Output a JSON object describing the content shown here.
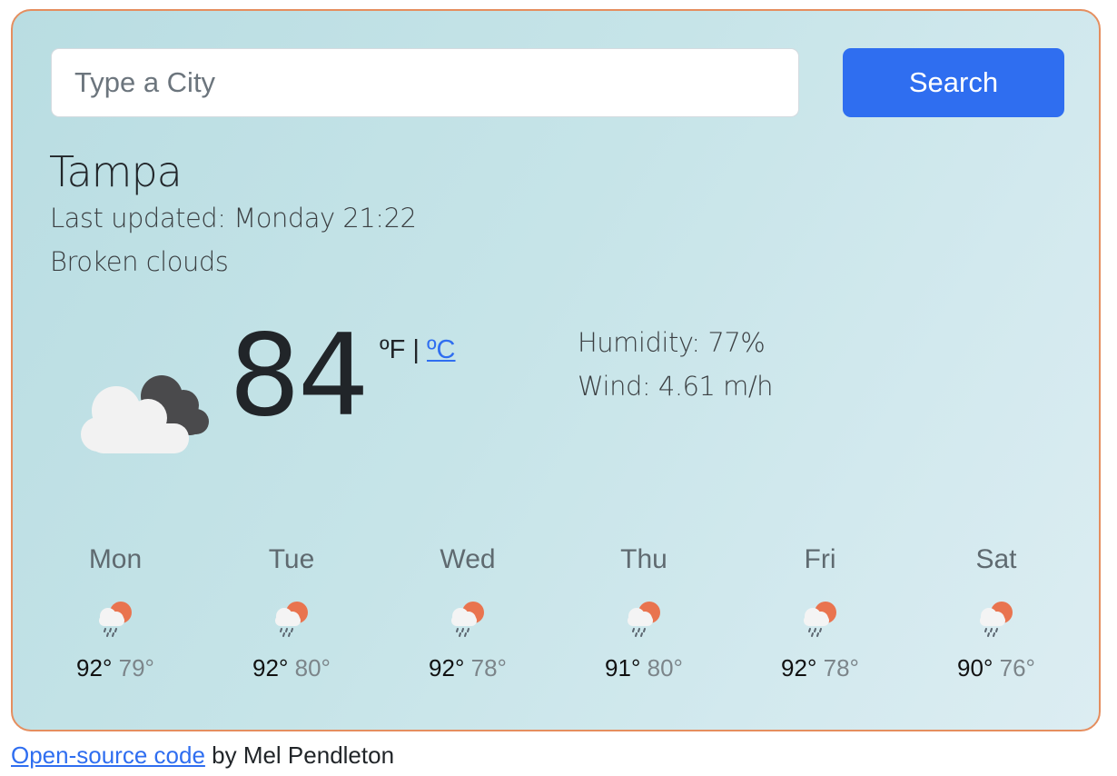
{
  "search": {
    "placeholder": "Type a City",
    "button_label": "Search"
  },
  "current": {
    "city": "Tampa",
    "last_updated": "Last updated: Monday 21:22",
    "description": "Broken clouds",
    "icon": "broken-clouds-icon",
    "temperature": "84",
    "unit_f": "ºF",
    "unit_separator": " | ",
    "unit_c": "ºC",
    "humidity": "Humidity: 77%",
    "wind": "Wind: 4.61 m/h"
  },
  "forecast": [
    {
      "day": "Mon",
      "icon": "rain-sun-icon",
      "max": "92°",
      "min": "79°"
    },
    {
      "day": "Tue",
      "icon": "rain-sun-icon",
      "max": "92°",
      "min": "80°"
    },
    {
      "day": "Wed",
      "icon": "rain-sun-icon",
      "max": "92°",
      "min": "78°"
    },
    {
      "day": "Thu",
      "icon": "rain-sun-icon",
      "max": "91°",
      "min": "80°"
    },
    {
      "day": "Fri",
      "icon": "rain-sun-icon",
      "max": "92°",
      "min": "78°"
    },
    {
      "day": "Sat",
      "icon": "rain-sun-icon",
      "max": "90°",
      "min": "76°"
    }
  ],
  "footer": {
    "link_text": "Open-source code",
    "text": " by Mel Pendleton"
  },
  "colors": {
    "accent": "#2f6ef0",
    "card_border": "#e58e5f",
    "card_bg": "#c6e4e8",
    "sun": "#e9744f"
  }
}
